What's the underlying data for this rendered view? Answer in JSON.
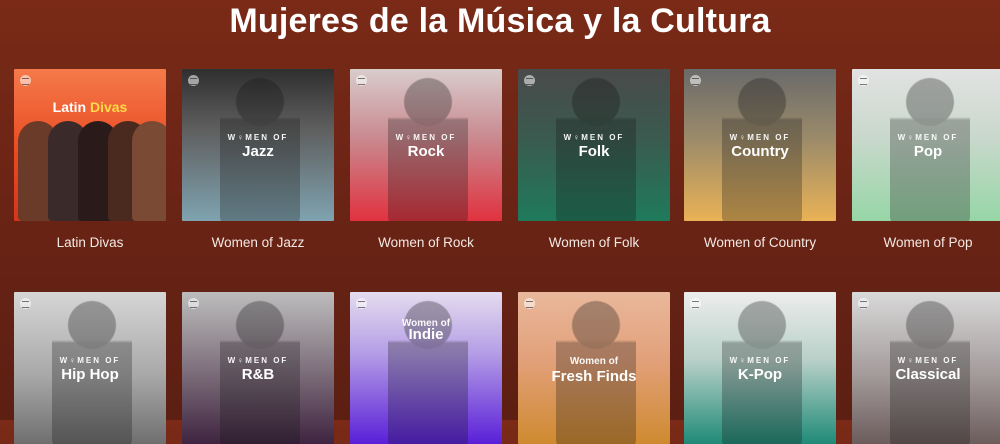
{
  "page": {
    "title": "Mujeres de la Música y la Cultura"
  },
  "brand_label": "W♀MEN OF",
  "playlists": [
    {
      "caption": "Latin Divas",
      "title_a": "Latin",
      "title_b": "Divas",
      "gradient": [
        "#f06a3a",
        "#d93b1e"
      ]
    },
    {
      "caption": "Women of Jazz",
      "genre": "Jazz",
      "gradient": [
        "#3a3a3a",
        "#7fa3b0"
      ]
    },
    {
      "caption": "Women of Rock",
      "genre": "Rock",
      "gradient": [
        "#c9a0a8",
        "#d72f3e"
      ]
    },
    {
      "caption": "Women of Folk",
      "genre": "Folk",
      "gradient": [
        "#5a5a5a",
        "#1f7a5c"
      ]
    },
    {
      "caption": "Women of Country",
      "genre": "Country",
      "gradient": [
        "#6b6b6b",
        "#e7b457"
      ]
    },
    {
      "caption": "Women of Pop",
      "genre": "Pop",
      "gradient": [
        "#d8d8d8",
        "#98d4a6"
      ]
    },
    {
      "caption": "",
      "genre": "Hip Hop",
      "gradient": [
        "#cfcfcf",
        "#7b7b7b"
      ]
    },
    {
      "caption": "",
      "genre": "R&B",
      "gradient": [
        "#aaaaaa",
        "#4a2a45"
      ]
    },
    {
      "caption": "",
      "brand_top": "Women of",
      "genre": "Indie",
      "gradient": [
        "#c7b6e6",
        "#5c1fd6"
      ]
    },
    {
      "caption": "",
      "brand_top": "Women of",
      "genre": "Fresh Finds",
      "gradient": [
        "#e7a07a",
        "#d28a2d"
      ]
    },
    {
      "caption": "",
      "genre": "K-Pop",
      "gradient": [
        "#e0e0e0",
        "#1f8a77"
      ]
    },
    {
      "caption": "",
      "genre": "Classical",
      "gradient": [
        "#cfcfcf",
        "#7a6a6a"
      ]
    }
  ]
}
